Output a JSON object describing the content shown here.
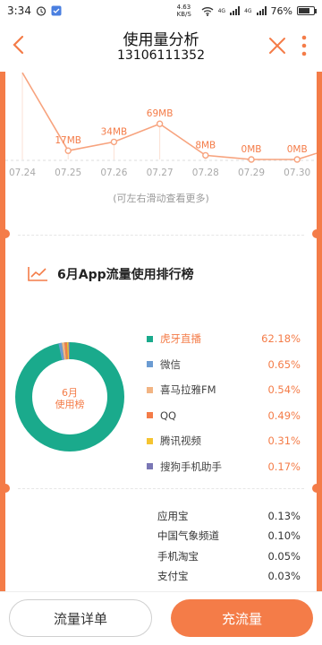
{
  "status_bar": {
    "time": "3:34",
    "net_speed": "4.63 KB/S",
    "battery": "76%",
    "battery_level": 0.76,
    "signal_1": "4G",
    "signal_2": "4G"
  },
  "header": {
    "title": "使用量分析",
    "subtitle": "13106111352"
  },
  "daily_chart": {
    "hint": "(可左右滑动查看更多)",
    "accent_color": "#f47c48",
    "chart_data": {
      "type": "line",
      "categories": [
        "07.24",
        "07.25",
        "07.26",
        "07.27",
        "07.28",
        "07.29",
        "07.30"
      ],
      "values": [
        168,
        17,
        34,
        69,
        8,
        0,
        0
      ],
      "data_labels": [
        "",
        "17MB",
        "34MB",
        "69MB",
        "8MB",
        "0MB",
        "0MB"
      ],
      "ylim": [
        0,
        170
      ],
      "grid": false
    }
  },
  "ranking": {
    "title": "6月App流量使用排行榜",
    "center_label_line1": "6月",
    "center_label_line2": "使用榜",
    "chart_data": {
      "type": "pie",
      "categories": [
        "虎牙直播",
        "微信",
        "喜马拉雅FM",
        "QQ",
        "腾讯视频",
        "搜狗手机助手"
      ],
      "values": [
        62.18,
        0.65,
        0.54,
        0.49,
        0.31,
        0.17
      ],
      "value_labels": [
        "62.18%",
        "0.65%",
        "0.54%",
        "0.49%",
        "0.31%",
        "0.17%"
      ],
      "colors": [
        "#1aaa8c",
        "#6b9bd2",
        "#f2b483",
        "#f47c48",
        "#f5c431",
        "#7a77b5"
      ]
    },
    "others": [
      {
        "name": "应用宝",
        "value": "0.13%"
      },
      {
        "name": "中国气象频道",
        "value": "0.10%"
      },
      {
        "name": "手机淘宝",
        "value": "0.05%"
      },
      {
        "name": "支付宝",
        "value": "0.03%"
      }
    ]
  },
  "bottom": {
    "detail_label": "流量详单",
    "recharge_label": "充流量"
  },
  "icons": {
    "back": "chevron-left-icon",
    "close": "close-icon",
    "more": "more-vertical-icon",
    "rank": "trend-chart-icon"
  }
}
